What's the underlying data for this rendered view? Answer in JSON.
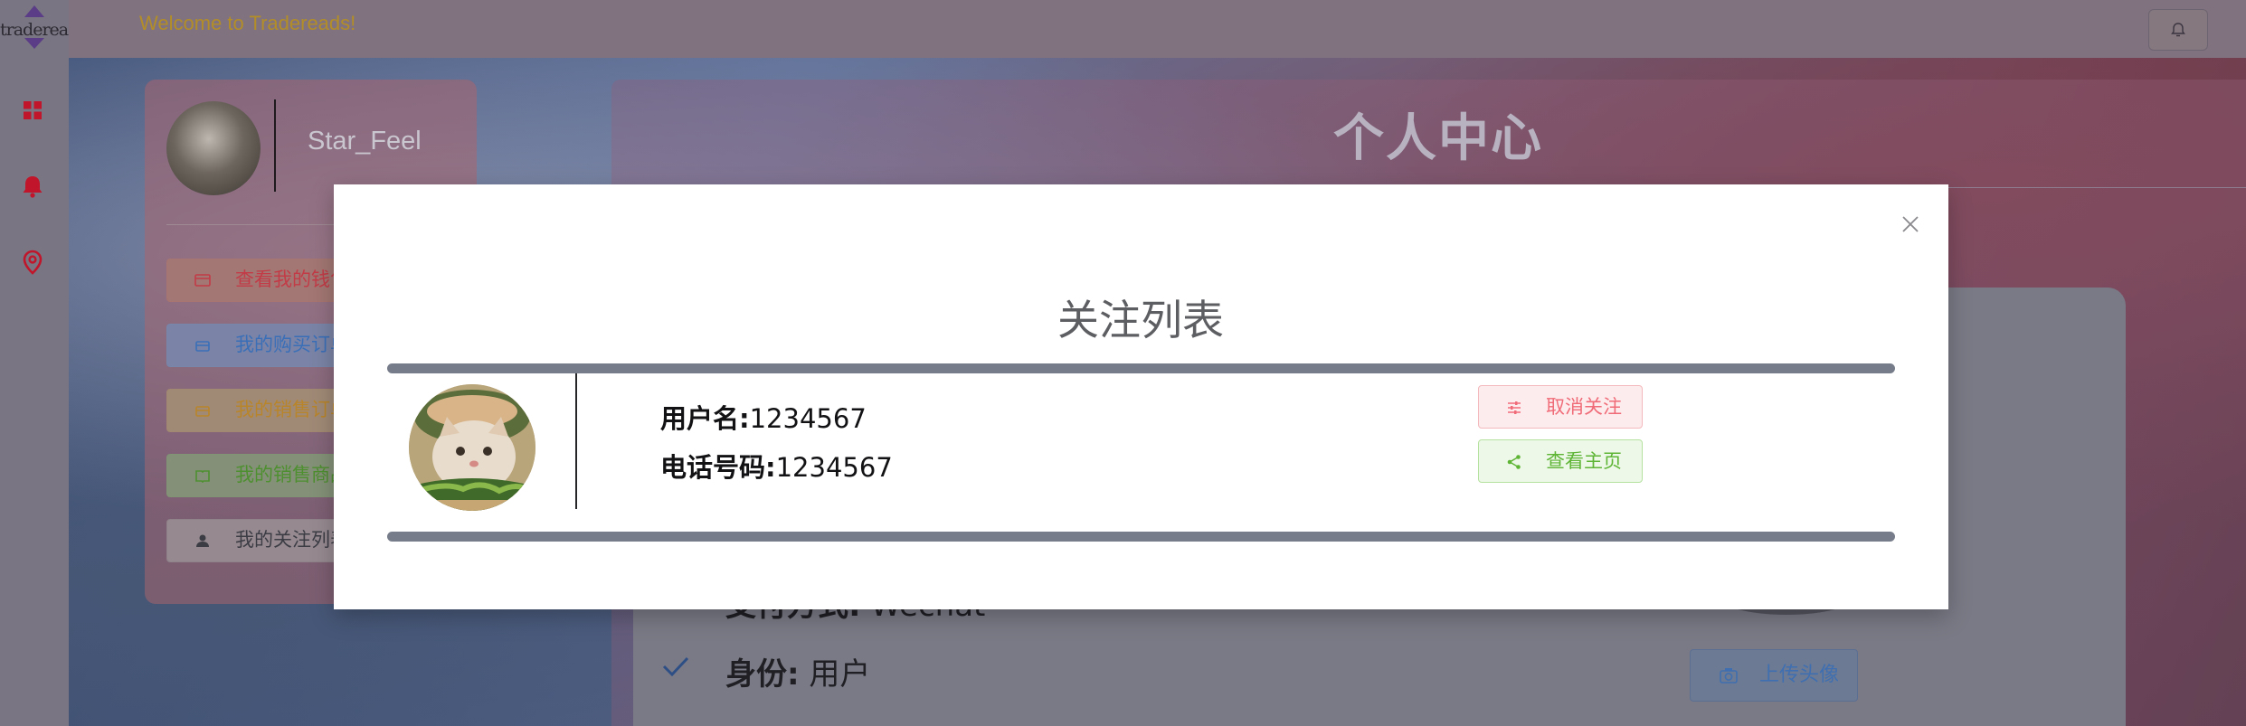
{
  "app": {
    "logo_text": "tradereads",
    "welcome": "Welcome to Tradereads!"
  },
  "profile_sidebar": {
    "username": "Star_Feel",
    "items": [
      {
        "label": "查看我的钱包",
        "icon": "wallet-icon",
        "color": "#c23b47"
      },
      {
        "label": "我的购买订单",
        "icon": "box-icon",
        "color": "#3a6fb8"
      },
      {
        "label": "我的销售订单",
        "icon": "box-icon",
        "color": "#b9852a"
      },
      {
        "label": "我的销售商品",
        "icon": "book-icon",
        "color": "#4e8f30"
      },
      {
        "label": "我的关注列表",
        "icon": "user-icon",
        "color": "#3c3c45"
      }
    ]
  },
  "main": {
    "title": "个人中心",
    "payment": {
      "label": "支付方式:",
      "value": "Wechat"
    },
    "identity": {
      "label": "身份:",
      "value": "用户"
    },
    "upload_avatar": "上传头像"
  },
  "modal": {
    "title": "关注列表",
    "entries": [
      {
        "username_label": "用户名:",
        "username": "1234567",
        "phone_label": "电话号码:",
        "phone": "1234567",
        "unfollow_label": "取消关注",
        "view_home_label": "查看主页"
      }
    ]
  },
  "colors": {
    "accent_red": "#c0152a",
    "unfollow": "#f06b78",
    "home": "#5eb535",
    "bar": "#767c89"
  }
}
